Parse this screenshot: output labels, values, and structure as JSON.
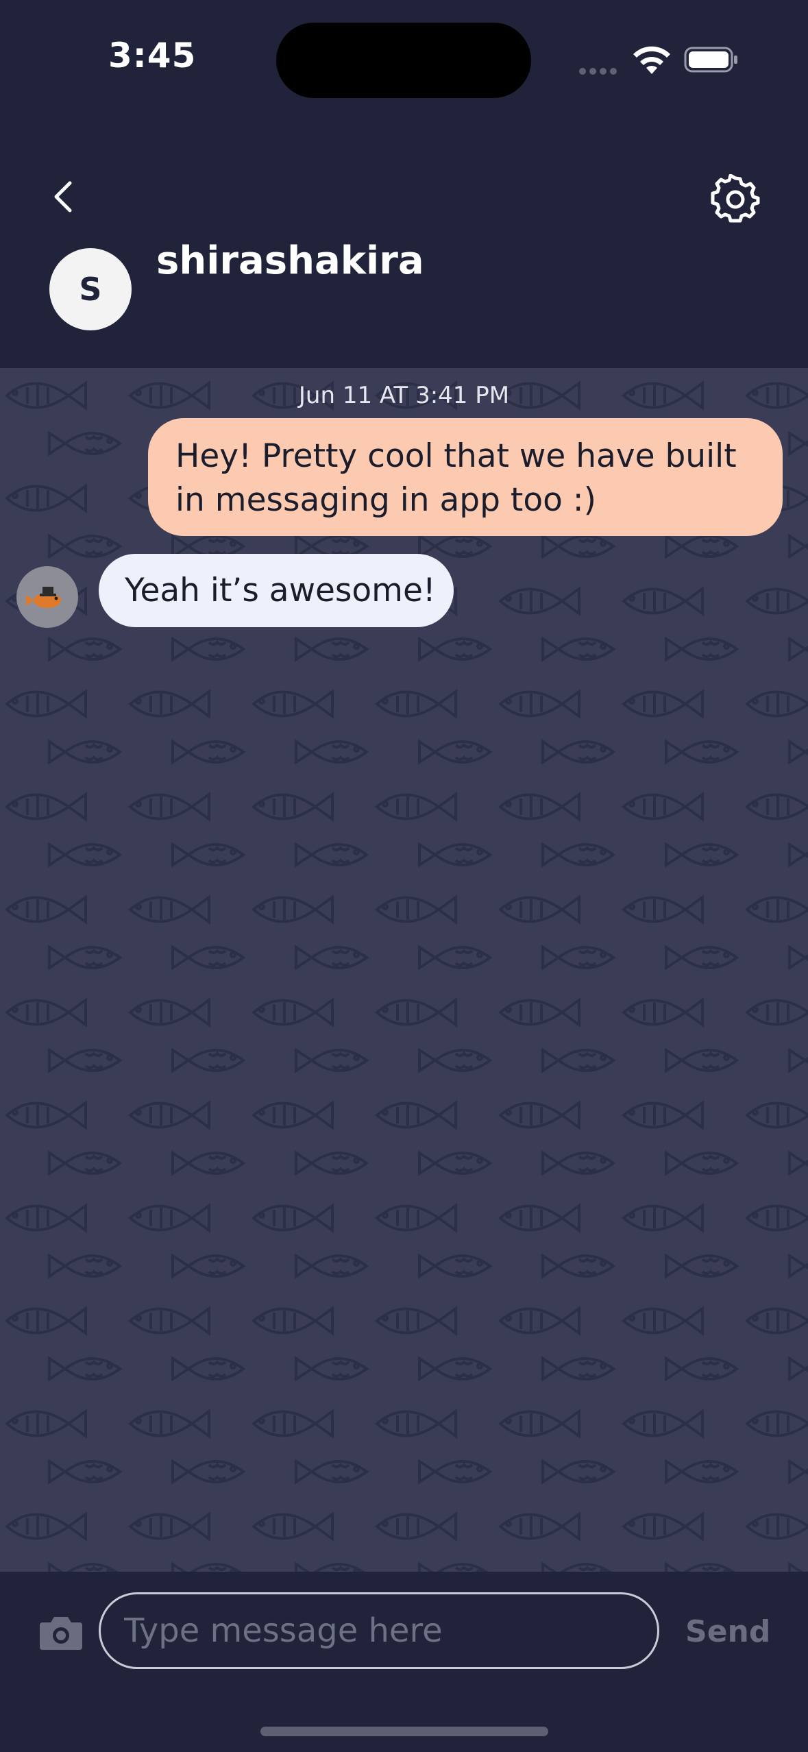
{
  "status_bar": {
    "time": "3:45"
  },
  "header": {
    "avatar_initial": "S",
    "username": "shirashakira",
    "back_icon": "chevron-left-icon",
    "settings_icon": "gear-icon"
  },
  "chat": {
    "timestamp": "Jun 11 AT 3:41 PM",
    "messages": [
      {
        "direction": "outgoing",
        "text": "Hey! Pretty cool that we have built in messaging in app too :)"
      },
      {
        "direction": "incoming",
        "text": "Yeah it’s awesome!"
      }
    ],
    "background_pattern": "fish-pattern"
  },
  "composer": {
    "placeholder": "Type message here",
    "value": "",
    "send_label": "Send",
    "camera_icon": "camera-icon"
  },
  "colors": {
    "app_bg": "#20233a",
    "chat_bg": "#3b3d56",
    "outgoing_bubble": "#fbcab0",
    "incoming_bubble": "#eef0fb"
  }
}
